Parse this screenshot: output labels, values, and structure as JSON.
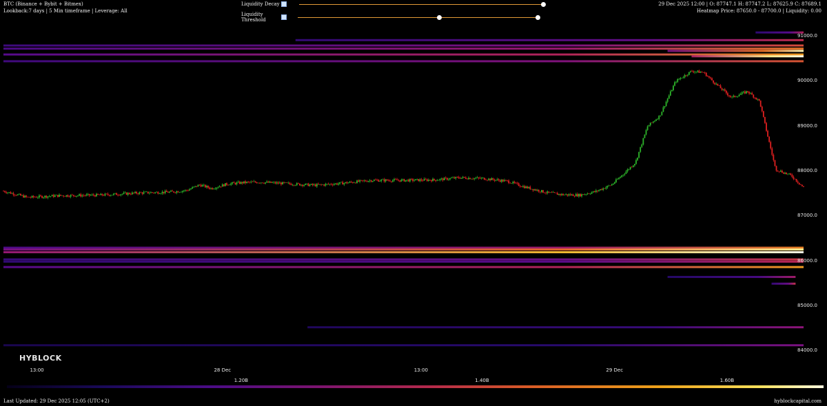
{
  "header": {
    "symbol_line": "BTC (Binance + Bybit + Bitmex)",
    "lookback_line": "Lookback:7 days | 5 Min timeframe | Leverage: All",
    "ohlc_line": "29 Dec 2025 12:00 | O: 87747.1 H: 87747.2 L: 87625.9 C: 87689.1",
    "heatmap_line": "Heatmap Price: 87650.0 - 87700.0 | Liquidity: 0.00"
  },
  "controls": {
    "decay": {
      "label": "Liquidity Decay",
      "value": 1.0
    },
    "threshold": {
      "label": "Liquidity Threshold",
      "low": 0.59,
      "high": 1.0
    }
  },
  "colors": {
    "up": "#2db52a",
    "down": "#e02020"
  },
  "brand": {
    "logo": "HYBLOCK",
    "site": "hyblockcapital.com"
  },
  "footer": {
    "updated": "Last Updated: 29 Dec 2025 12:05 (UTC+2)"
  },
  "colorbar": {
    "labels": [
      "1.20B",
      "1.40B",
      "1.60B"
    ]
  },
  "chart_data": {
    "type": "heatmap",
    "y_ticks": [
      "91000.0",
      "90000.0",
      "89000.0",
      "88000.0",
      "87000.0",
      "86000.0",
      "85000.0",
      "84000.0"
    ],
    "y_tick_values": [
      91000,
      90000,
      89000,
      88000,
      87000,
      86000,
      85000,
      84000
    ],
    "ylim": [
      83850,
      91200
    ],
    "x_ticks": [
      "13:00",
      "28 Dec",
      "13:00",
      "29 Dec"
    ],
    "x_tick_values": [
      0.04,
      0.27,
      0.52,
      0.76
    ],
    "price_path": [
      [
        0.0,
        87560
      ],
      [
        0.03,
        87420
      ],
      [
        0.07,
        87460
      ],
      [
        0.12,
        87470
      ],
      [
        0.17,
        87520
      ],
      [
        0.21,
        87540
      ],
      [
        0.23,
        87580
      ],
      [
        0.245,
        87700
      ],
      [
        0.26,
        87620
      ],
      [
        0.28,
        87720
      ],
      [
        0.3,
        87750
      ],
      [
        0.32,
        87760
      ],
      [
        0.36,
        87720
      ],
      [
        0.39,
        87690
      ],
      [
        0.42,
        87730
      ],
      [
        0.46,
        87800
      ],
      [
        0.5,
        87800
      ],
      [
        0.54,
        87810
      ],
      [
        0.57,
        87860
      ],
      [
        0.6,
        87840
      ],
      [
        0.63,
        87780
      ],
      [
        0.65,
        87660
      ],
      [
        0.68,
        87520
      ],
      [
        0.7,
        87480
      ],
      [
        0.72,
        87470
      ],
      [
        0.74,
        87550
      ],
      [
        0.76,
        87700
      ],
      [
        0.77,
        87860
      ],
      [
        0.79,
        88200
      ],
      [
        0.805,
        89000
      ],
      [
        0.82,
        89230
      ],
      [
        0.84,
        90000
      ],
      [
        0.86,
        90230
      ],
      [
        0.875,
        90200
      ],
      [
        0.89,
        89950
      ],
      [
        0.91,
        89640
      ],
      [
        0.93,
        89780
      ],
      [
        0.945,
        89560
      ],
      [
        0.955,
        88800
      ],
      [
        0.965,
        88050
      ],
      [
        0.985,
        87900
      ],
      [
        1.0,
        87640
      ]
    ],
    "liquidity_bands": [
      {
        "price": 91090,
        "x0": 0.94,
        "x1": 1.0,
        "intensity": 0.3
      },
      {
        "price": 90920,
        "x0": 0.365,
        "x1": 1.0,
        "intensity": 0.34
      },
      {
        "price": 90800,
        "x0": 0.0,
        "x1": 1.0,
        "intensity": 0.4
      },
      {
        "price": 90730,
        "x0": 0.0,
        "x1": 1.0,
        "intensity": 0.48
      },
      {
        "price": 90680,
        "x0": 0.83,
        "x1": 1.0,
        "intensity": 0.72
      },
      {
        "price": 90600,
        "x0": 0.0,
        "x1": 1.0,
        "intensity": 0.55
      },
      {
        "price": 90560,
        "x0": 0.86,
        "x1": 1.0,
        "intensity": 0.95
      },
      {
        "price": 90450,
        "x0": 0.0,
        "x1": 1.0,
        "intensity": 0.42
      },
      {
        "price": 86300,
        "x0": 0.0,
        "x1": 1.0,
        "intensity": 0.5
      },
      {
        "price": 86260,
        "x0": 0.0,
        "x1": 1.0,
        "intensity": 0.7
      },
      {
        "price": 86200,
        "x0": 0.0,
        "x1": 1.0,
        "intensity": 0.85
      },
      {
        "price": 86040,
        "x0": 0.0,
        "x1": 1.0,
        "intensity": 0.36
      },
      {
        "price": 85990,
        "x0": 0.0,
        "x1": 1.0,
        "intensity": 0.32
      },
      {
        "price": 85870,
        "x0": 0.0,
        "x1": 1.0,
        "intensity": 0.55
      },
      {
        "price": 85650,
        "x0": 0.83,
        "x1": 0.99,
        "intensity": 0.25
      },
      {
        "price": 85500,
        "x0": 0.96,
        "x1": 0.99,
        "intensity": 0.35
      },
      {
        "price": 84530,
        "x0": 0.38,
        "x1": 1.0,
        "intensity": 0.2
      },
      {
        "price": 84130,
        "x0": 0.0,
        "x1": 1.0,
        "intensity": 0.15
      }
    ]
  }
}
